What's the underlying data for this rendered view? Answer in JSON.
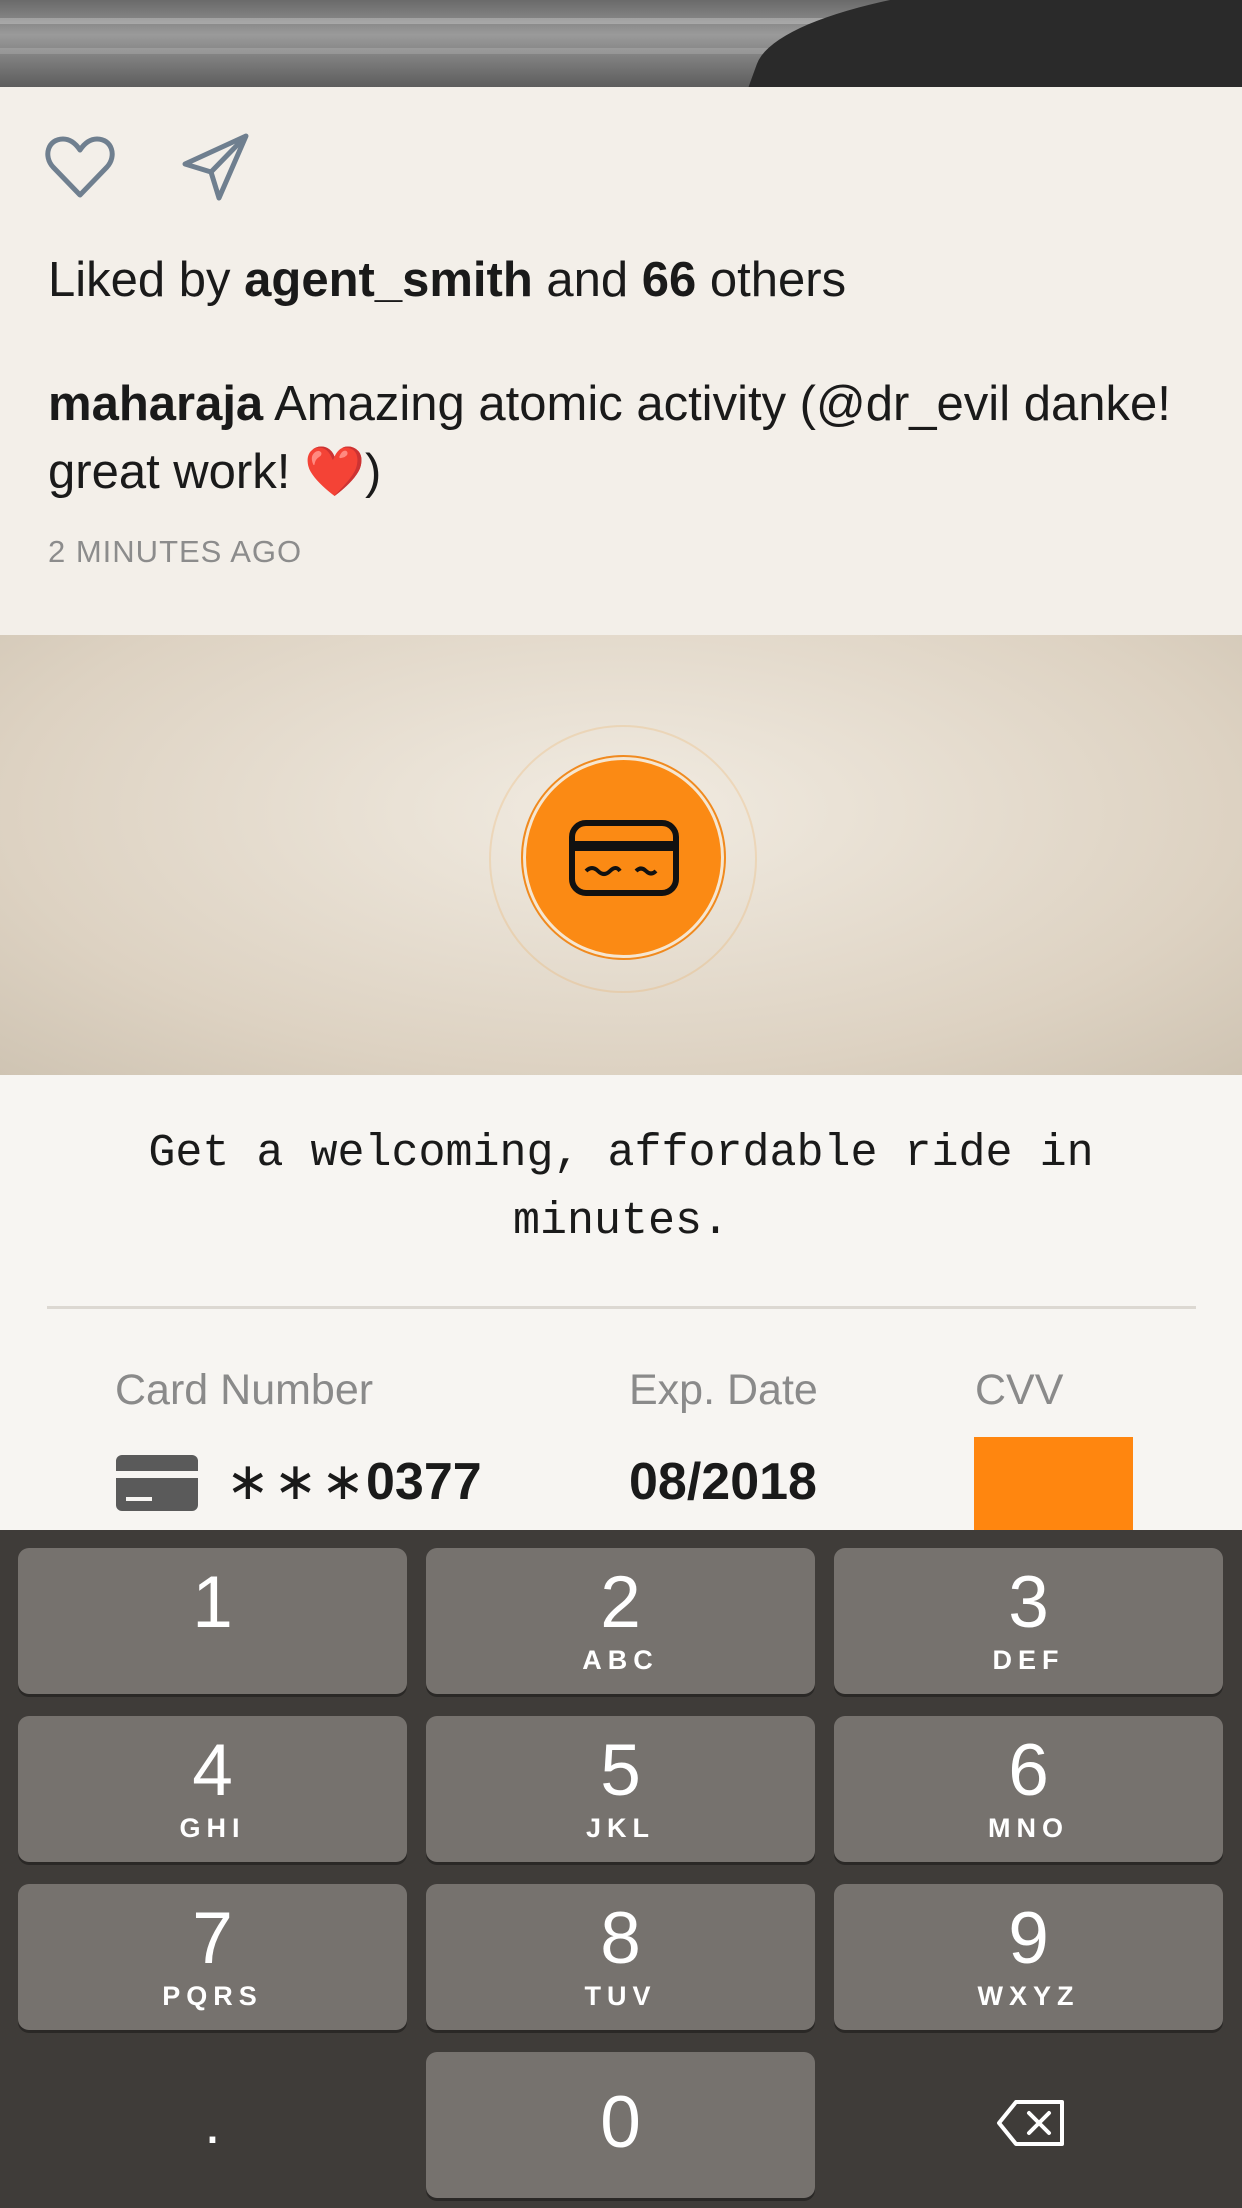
{
  "post": {
    "liked_prefix": "Liked by",
    "liked_user": "agent_smith",
    "liked_and": "and",
    "liked_count": "66",
    "liked_suffix": "others",
    "caption_user": "maharaja",
    "caption_text": "Amazing atomic activity (@dr_evil danke! great work!",
    "caption_heart": "❤️",
    "caption_close": ")",
    "timestamp": "2 MINUTES AGO"
  },
  "promo": {
    "headline": "Get a welcoming, affordable ride in minutes."
  },
  "payment": {
    "card_number_label": "Card Number",
    "card_mask": "∗∗∗",
    "card_last4": "0377",
    "exp_label": "Exp. Date",
    "exp_value": "08/2018",
    "cvv_label": "CVV",
    "cvv_value": ""
  },
  "keypad": {
    "keys": [
      {
        "num": "1",
        "letters": ""
      },
      {
        "num": "2",
        "letters": "ABC"
      },
      {
        "num": "3",
        "letters": "DEF"
      },
      {
        "num": "4",
        "letters": "GHI"
      },
      {
        "num": "5",
        "letters": "JKL"
      },
      {
        "num": "6",
        "letters": "MNO"
      },
      {
        "num": "7",
        "letters": "PQRS"
      },
      {
        "num": "8",
        "letters": "TUV"
      },
      {
        "num": "9",
        "letters": "WXYZ"
      },
      {
        "num": "0",
        "letters": ""
      }
    ],
    "dot": "."
  },
  "colors": {
    "accent": "#ff860f",
    "keypad_bg": "#3f3c39",
    "key_bg": "#76726e"
  },
  "icons": [
    "heart-icon",
    "send-icon",
    "credit-card-icon",
    "card-icon",
    "backspace-icon"
  ]
}
